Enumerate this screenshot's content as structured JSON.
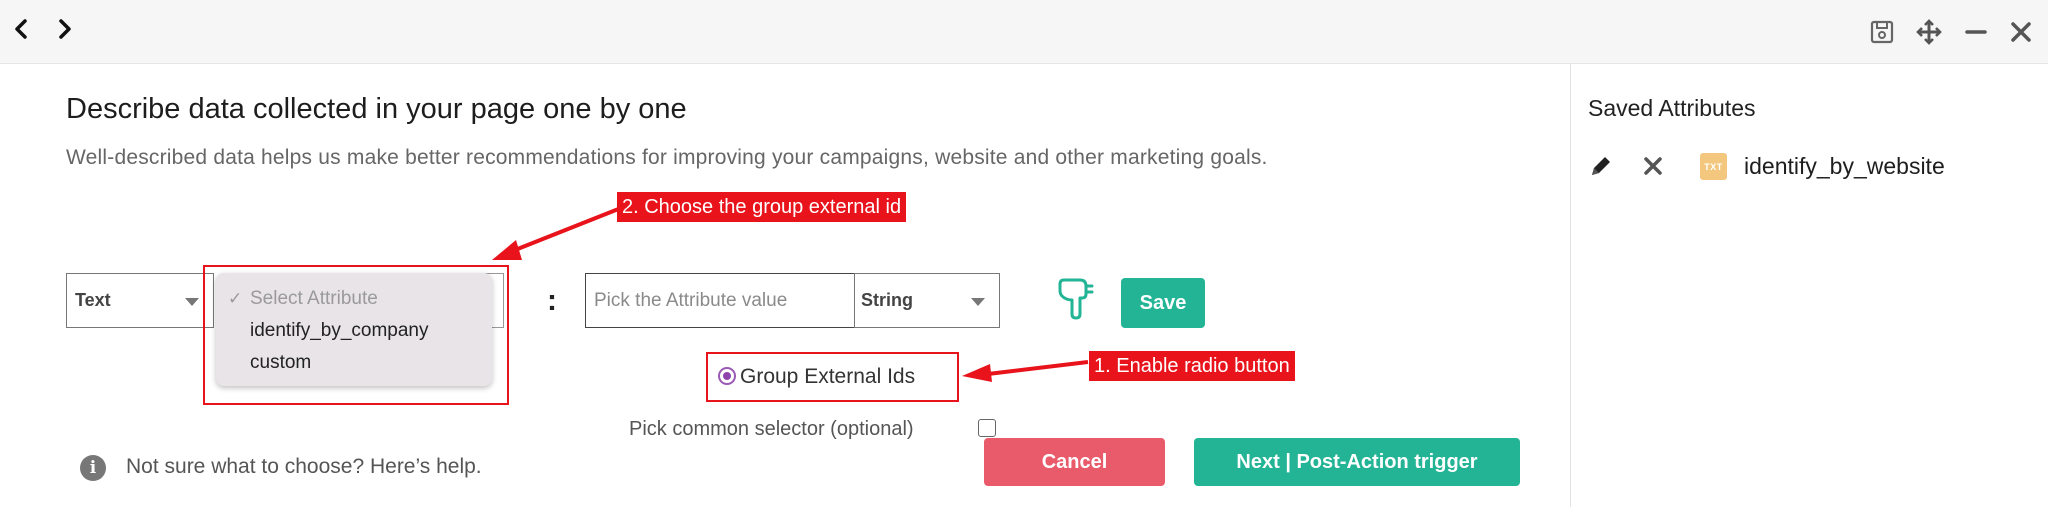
{
  "toolbar": {
    "back_icon": "chevron-left-icon",
    "forward_icon": "chevron-right-icon",
    "window_icons": [
      "save-icon",
      "move-icon",
      "minimize-icon",
      "close-icon"
    ]
  },
  "main": {
    "title": "Describe data collected in your page one by one",
    "subtitle": "Well-described data helps us make better recommendations for improving your campaigns, website and other marketing goals.",
    "type_select": {
      "selected": "Text"
    },
    "attribute_select": {
      "placeholder": "Select Attribute",
      "options": [
        "identify_by_company",
        "custom"
      ]
    },
    "colon": ":",
    "value_input": {
      "placeholder": "Pick the Attribute value",
      "value": ""
    },
    "value_type_select": {
      "selected": "String"
    },
    "save_label": "Save",
    "radio_label": "Group External Ids",
    "common_selector_label": "Pick common selector (optional)",
    "help_text": "Not sure what to choose? Here’s help.",
    "help_icon_glyph": "i",
    "cancel_label": "Cancel",
    "next_label": "Next | Post-Action trigger"
  },
  "annotations": {
    "callout_2": "2. Choose the group external id",
    "callout_1": "1. Enable radio button",
    "color": "#e8131b"
  },
  "saved_attributes": {
    "title": "Saved Attributes",
    "items": [
      {
        "badge": "TXT",
        "name": "identify_by_website"
      }
    ]
  },
  "colors": {
    "primary": "#22b495",
    "cancel": "#e95a6b",
    "radio": "#8e44ad",
    "badge": "#f3c87e"
  }
}
